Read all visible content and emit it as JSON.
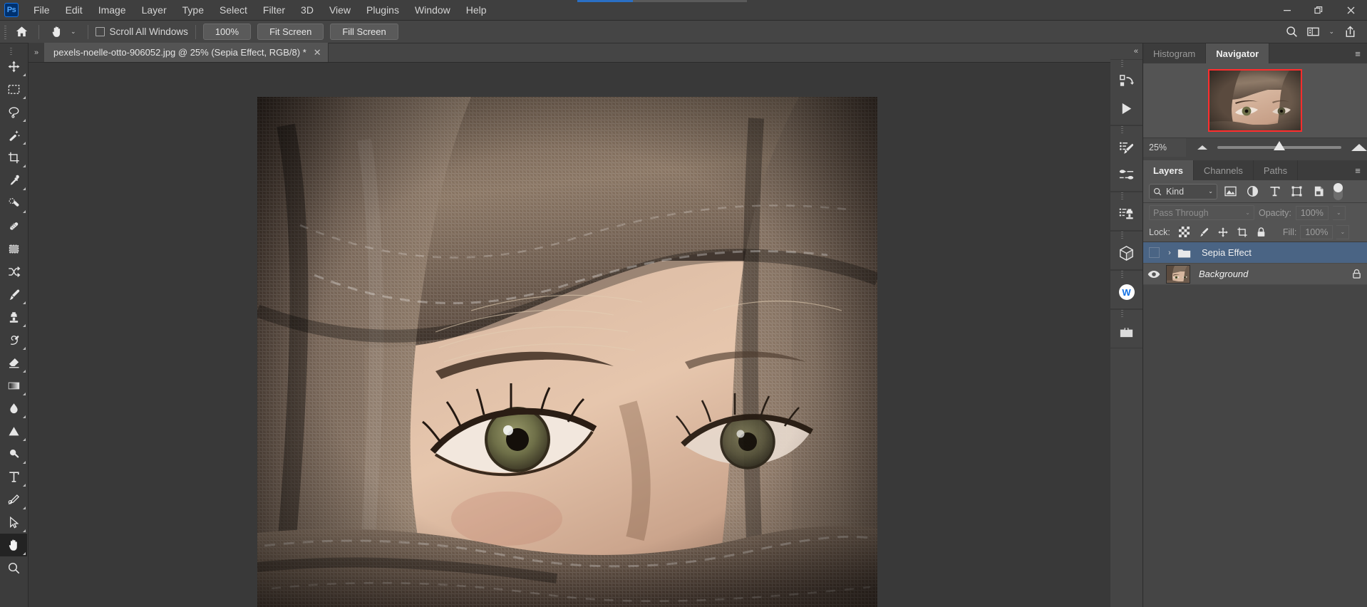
{
  "app": {
    "logo_text": "Ps",
    "logo_name": "photoshop-logo"
  },
  "menubar": {
    "items": [
      {
        "label": "File"
      },
      {
        "label": "Edit"
      },
      {
        "label": "Image"
      },
      {
        "label": "Layer"
      },
      {
        "label": "Type"
      },
      {
        "label": "Select"
      },
      {
        "label": "Filter"
      },
      {
        "label": "3D"
      },
      {
        "label": "View"
      },
      {
        "label": "Plugins"
      },
      {
        "label": "Window"
      },
      {
        "label": "Help"
      }
    ]
  },
  "window_controls": {
    "minimize": "—",
    "restore": "❐",
    "close": "✕"
  },
  "options_bar": {
    "home_icon": "home-icon",
    "tool_icon": "hand-tool-icon",
    "tool_preset_chevron": "⌄",
    "scroll_all_windows_label": "Scroll All Windows",
    "scroll_all_windows_checked": false,
    "zoom_100_label": "100%",
    "fit_screen_label": "Fit Screen",
    "fill_screen_label": "Fill Screen",
    "search_icon": "search-icon",
    "workspace_icon": "workspace-icon",
    "workspace_chevron": "⌄",
    "share_icon": "share-icon"
  },
  "toolbar": {
    "tools": [
      {
        "name": "move-tool",
        "has_flyout": true
      },
      {
        "name": "rectangular-marquee-tool",
        "has_flyout": true
      },
      {
        "name": "lasso-tool",
        "has_flyout": true
      },
      {
        "name": "magic-wand-tool",
        "has_flyout": true
      },
      {
        "name": "crop-tool",
        "has_flyout": true
      },
      {
        "name": "eyedropper-tool",
        "has_flyout": true
      },
      {
        "name": "spot-healing-brush-tool",
        "has_flyout": true
      },
      {
        "name": "patch-tool",
        "has_flyout": false
      },
      {
        "name": "content-aware-move-tool",
        "has_flyout": false
      },
      {
        "name": "shuffle-tool",
        "has_flyout": false
      },
      {
        "name": "brush-tool",
        "has_flyout": true
      },
      {
        "name": "clone-stamp-tool",
        "has_flyout": true
      },
      {
        "name": "history-brush-tool",
        "has_flyout": true
      },
      {
        "name": "eraser-tool",
        "has_flyout": true
      },
      {
        "name": "gradient-tool",
        "has_flyout": true
      },
      {
        "name": "blur-tool",
        "has_flyout": true
      },
      {
        "name": "dodge-tool",
        "has_flyout": true
      },
      {
        "name": "burn-tool",
        "has_flyout": true
      },
      {
        "name": "type-tool",
        "has_flyout": true
      },
      {
        "name": "pen-tool",
        "has_flyout": true
      },
      {
        "name": "path-selection-tool",
        "has_flyout": true
      },
      {
        "name": "hand-tool",
        "has_flyout": true,
        "active": true
      },
      {
        "name": "zoom-tool",
        "has_flyout": false
      }
    ]
  },
  "document": {
    "tab_title": "pexels-noelle-otto-906052.jpg @ 25% (Sepia Effect, RGB/8) *",
    "close_glyph": "✕",
    "expand_glyph": "»"
  },
  "icon_dock": {
    "collapse_glyph": "«",
    "icons": [
      {
        "name": "history-panel-icon"
      },
      {
        "name": "actions-panel-icon"
      },
      {
        "name": "brush-settings-panel-icon"
      },
      {
        "name": "brushes-panel-icon"
      },
      {
        "name": "clone-source-panel-icon"
      },
      {
        "name": "3d-panel-icon"
      },
      {
        "name": "wacom-badge-icon",
        "text": "W"
      },
      {
        "name": "libraries-panel-icon"
      }
    ]
  },
  "navigator_panel": {
    "tabs": [
      {
        "label": "Histogram",
        "active": false
      },
      {
        "label": "Navigator",
        "active": true
      }
    ],
    "menu_glyph": "≡",
    "zoom_value": "25%",
    "view_box_color": "#ff2d2d"
  },
  "layers_panel": {
    "tabs": [
      {
        "label": "Layers",
        "active": true
      },
      {
        "label": "Channels",
        "active": false
      },
      {
        "label": "Paths",
        "active": false
      }
    ],
    "menu_glyph": "≡",
    "filter": {
      "search_icon": "search-icon",
      "kind_label": "Kind",
      "chevron": "⌄",
      "icons": [
        {
          "name": "filter-pixel-layers-icon"
        },
        {
          "name": "filter-adjustment-layers-icon"
        },
        {
          "name": "filter-type-layers-icon"
        },
        {
          "name": "filter-shape-layers-icon"
        },
        {
          "name": "filter-smart-object-layers-icon"
        }
      ],
      "toggle_name": "filter-enable-toggle"
    },
    "blend_mode": "Pass Through",
    "blend_chevron": "⌄",
    "opacity_label": "Opacity:",
    "opacity_value": "100%",
    "fill_label": "Fill:",
    "fill_value": "100%",
    "lock_label": "Lock:",
    "lock_icons": [
      {
        "name": "lock-transparent-pixels-icon"
      },
      {
        "name": "lock-image-pixels-icon"
      },
      {
        "name": "lock-position-icon"
      },
      {
        "name": "lock-artboard-nesting-icon"
      },
      {
        "name": "lock-all-icon"
      }
    ],
    "layers": [
      {
        "name": "Sepia Effect",
        "type": "group",
        "selected": true,
        "visible": false,
        "italic": false,
        "locked": false,
        "disclosure": "›"
      },
      {
        "name": "Background",
        "type": "image",
        "selected": false,
        "visible": true,
        "italic": true,
        "locked": true,
        "disclosure": ""
      }
    ]
  },
  "colors": {
    "titlebar_bg": "#3f3f3f",
    "options_bg": "#454545",
    "panel_bg": "#545454",
    "canvas_bg": "#393939",
    "toolbar_bg": "#3c3c3c",
    "selection_blue": "#4a6484",
    "accent_blue": "#2a6fc4",
    "navigator_box": "#ff2d2d"
  }
}
